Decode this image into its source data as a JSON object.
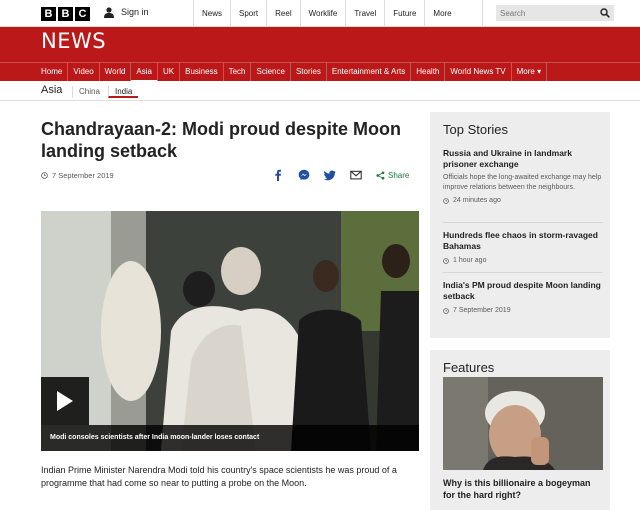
{
  "brand": {
    "logo_letters": [
      "B",
      "B",
      "C"
    ],
    "section_wordmark": "NEWS"
  },
  "topbar": {
    "signin_label": "Sign in",
    "nav": [
      "News",
      "Sport",
      "Reel",
      "Worklife",
      "Travel",
      "Future",
      "More"
    ],
    "search_placeholder": "Search"
  },
  "main_nav": {
    "items": [
      "Home",
      "Video",
      "World",
      "Asia",
      "UK",
      "Business",
      "Tech",
      "Science",
      "Stories",
      "Entertainment & Arts",
      "Health",
      "World News TV",
      "More ▾"
    ],
    "active": "Asia"
  },
  "sub_nav": {
    "section": "Asia",
    "items": [
      "China",
      "India"
    ],
    "active": "India"
  },
  "article": {
    "headline": "Chandrayaan-2: Modi proud despite Moon landing setback",
    "date": "7 September 2019",
    "share_label": "Share",
    "video_caption": "Modi consoles scientists after India moon-lander loses contact",
    "body": "Indian Prime Minister Narendra Modi told his country's space scientists he was proud of a programme that had come so near to putting a probe on the Moon."
  },
  "top_stories": {
    "heading": "Top Stories",
    "stories": [
      {
        "title": "Russia and Ukraine in landmark prisoner exchange",
        "summary": "Officials hope the long-awaited exchange may help improve relations between the neighbours.",
        "time": "24 minutes ago"
      },
      {
        "title": "Hundreds flee chaos in storm-ravaged Bahamas",
        "summary": "",
        "time": "1 hour ago"
      },
      {
        "title": "India's PM proud despite Moon landing setback",
        "summary": "",
        "time": "7 September 2019"
      }
    ]
  },
  "features": {
    "heading": "Features",
    "items": [
      {
        "title": "Why is this billionaire a bogeyman for the hard right?"
      }
    ]
  },
  "colors": {
    "brand_red": "#bb1919",
    "share_green": "#1c7a3c",
    "panel_grey": "#ededed"
  }
}
